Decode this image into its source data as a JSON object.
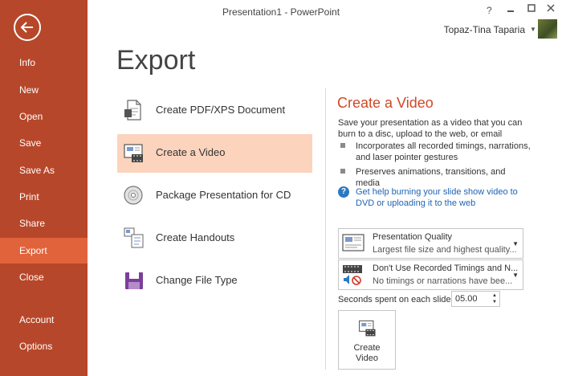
{
  "window": {
    "title": "Presentation1 - PowerPoint",
    "help": "?",
    "user": "Topaz-Tina Taparia"
  },
  "sidebar": {
    "items": [
      {
        "label": "Info"
      },
      {
        "label": "New"
      },
      {
        "label": "Open"
      },
      {
        "label": "Save"
      },
      {
        "label": "Save As"
      },
      {
        "label": "Print"
      },
      {
        "label": "Share"
      },
      {
        "label": "Export"
      },
      {
        "label": "Close"
      },
      {
        "label": "Account"
      },
      {
        "label": "Options"
      }
    ],
    "active": "Export"
  },
  "page": {
    "title": "Export"
  },
  "export_options": [
    {
      "label": "Create PDF/XPS Document",
      "icon": "pdf-document-icon"
    },
    {
      "label": "Create a Video",
      "icon": "video-icon"
    },
    {
      "label": "Package Presentation for CD",
      "icon": "cd-icon"
    },
    {
      "label": "Create Handouts",
      "icon": "handouts-icon"
    },
    {
      "label": "Change File Type",
      "icon": "file-type-icon"
    }
  ],
  "detail": {
    "title": "Create a Video",
    "description": "Save your presentation as a video that you can burn to a disc, upload to the web, or email",
    "bullets": [
      "Incorporates all recorded timings, narrations, and laser pointer gestures",
      "Preserves animations, transitions, and media"
    ],
    "help_link": "Get help burning your slide show video to DVD or uploading it to the web",
    "quality": {
      "main": "Presentation Quality",
      "sub": "Largest file size and highest quality..."
    },
    "timings": {
      "main": "Don't Use Recorded Timings and N...",
      "sub": "No timings or narrations have bee..."
    },
    "seconds_label": "Seconds spent on each slide:",
    "seconds_value": "05.00",
    "create_button": {
      "line1": "Create",
      "line2": "Video"
    }
  },
  "colors": {
    "sidebar": "#b7472a",
    "sidebar_active": "#e0633b",
    "option_active": "#fcd3bd",
    "accent": "#d24726",
    "link": "#1e64b4"
  }
}
